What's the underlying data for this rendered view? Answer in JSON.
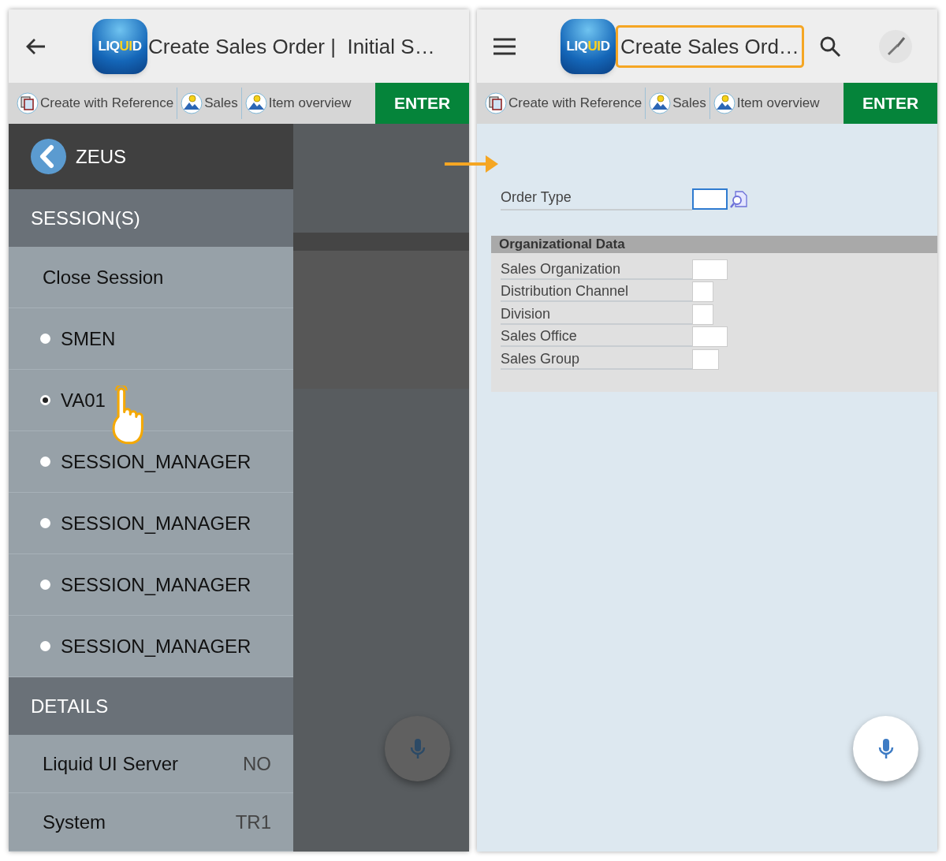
{
  "screens": [
    {
      "header": {
        "nav": {
          "kind": "back"
        },
        "logo": "LIQUID",
        "title": "Create Sales Order |  Initial S…",
        "title_highlighted": false
      },
      "toolbar": {
        "items": [
          {
            "kind": "document",
            "label": "Create with Reference"
          },
          {
            "kind": "image",
            "label": "Sales"
          },
          {
            "kind": "image",
            "label": "Item overview"
          }
        ],
        "enter": "ENTER"
      },
      "drawer": {
        "open": true,
        "title": "ZEUS",
        "sessions_heading": "SESSION(S)",
        "sessions": [
          {
            "kind": "action",
            "label": "Close Session"
          },
          {
            "kind": "session",
            "label": "SMEN",
            "selected": false
          },
          {
            "kind": "session",
            "label": "VA01",
            "selected": true
          },
          {
            "kind": "session",
            "label": "SESSION_MANAGER",
            "selected": false
          },
          {
            "kind": "session",
            "label": "SESSION_MANAGER",
            "selected": false
          },
          {
            "kind": "session",
            "label": "SESSION_MANAGER",
            "selected": false
          },
          {
            "kind": "session",
            "label": "SESSION_MANAGER",
            "selected": false
          }
        ],
        "details_heading": "DETAILS",
        "details": [
          {
            "label": "Liquid UI Server",
            "value": "NO"
          },
          {
            "label": "System",
            "value": "TR1"
          }
        ]
      }
    },
    {
      "header": {
        "nav": {
          "kind": "menu"
        },
        "logo": "LIQUID",
        "title": "Create Sales Ord…",
        "title_highlighted": true,
        "actions": [
          {
            "kind": "search"
          },
          {
            "kind": "tool"
          }
        ]
      },
      "toolbar": {
        "items": [
          {
            "kind": "document",
            "label": "Create with Reference"
          },
          {
            "kind": "image",
            "label": "Sales"
          },
          {
            "kind": "image",
            "label": "Item overview"
          }
        ],
        "enter": "ENTER"
      },
      "form": {
        "order_type": {
          "label": "Order Type"
        },
        "section": {
          "title": "Organizational Data",
          "fields": [
            {
              "label": "Sales Organization"
            },
            {
              "label": "Distribution Channel"
            },
            {
              "label": "Division"
            },
            {
              "label": "Sales Office"
            },
            {
              "label": "Sales Group"
            }
          ]
        }
      }
    }
  ]
}
